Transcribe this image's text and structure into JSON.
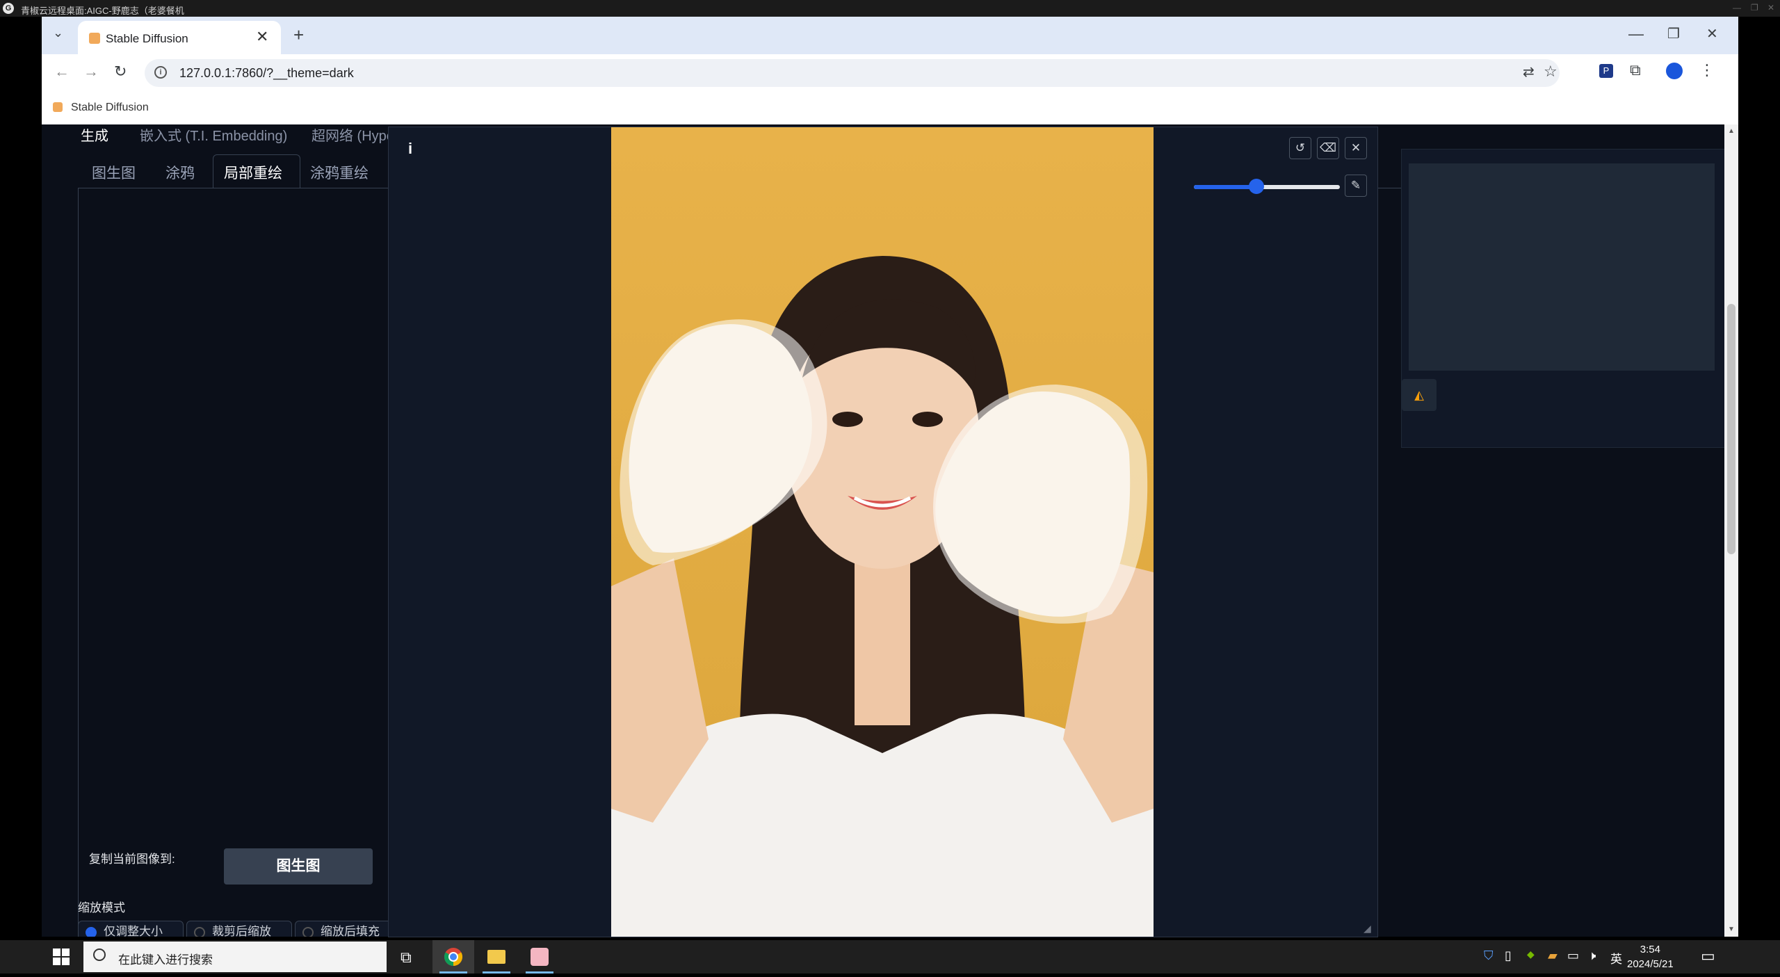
{
  "remote_desktop": {
    "title": "青椒云远程桌面:AIGC-野鹿志（老婆餐机",
    "logo_glyph": "G"
  },
  "browser": {
    "tab_title": "Stable Diffusion",
    "tab_close": "✕",
    "new_tab": "+",
    "url": "127.0.0.1:7860/?__theme=dark",
    "bookmark": "Stable Diffusion",
    "window_controls": {
      "minimize": "—",
      "restore": "❐",
      "close": "✕"
    },
    "icons": [
      "back-icon",
      "forward-icon",
      "reload-icon",
      "translate-icon",
      "star-icon",
      "extensions-icon",
      "profile-icon",
      "menu-icon"
    ]
  },
  "page": {
    "top_tabs": [
      "生成",
      "嵌入式 (T.I. Embedding)",
      "超网络 (Hype"
    ],
    "sub_tabs": [
      "图生图",
      "涂鸦",
      "局部重绘",
      "涂鸦重绘"
    ],
    "active_sub_tab": "局部重绘",
    "copy_to_label": "复制当前图像到:",
    "copy_to_button": "图生图",
    "resize_mode_label": "缩放模式",
    "resize_options": [
      "仅调整大小",
      "裁剪后缩放",
      "缩放后填充"
    ],
    "resize_selected": "仅调整大小"
  },
  "modal": {
    "info_glyph": "i",
    "undo_glyph": "↺",
    "eraser_glyph": "⌫",
    "close_glyph": "✕",
    "brush_glyph": "✎",
    "brush_size_fraction": 0.43
  },
  "taskbar": {
    "search_placeholder": "在此键入进行搜索",
    "time": "3:54",
    "date": "2024/5/21",
    "ime": "英"
  },
  "colors": {
    "page_bg": "#0b0f19",
    "accent": "#2563eb",
    "photo_bg": "#e8b445"
  }
}
